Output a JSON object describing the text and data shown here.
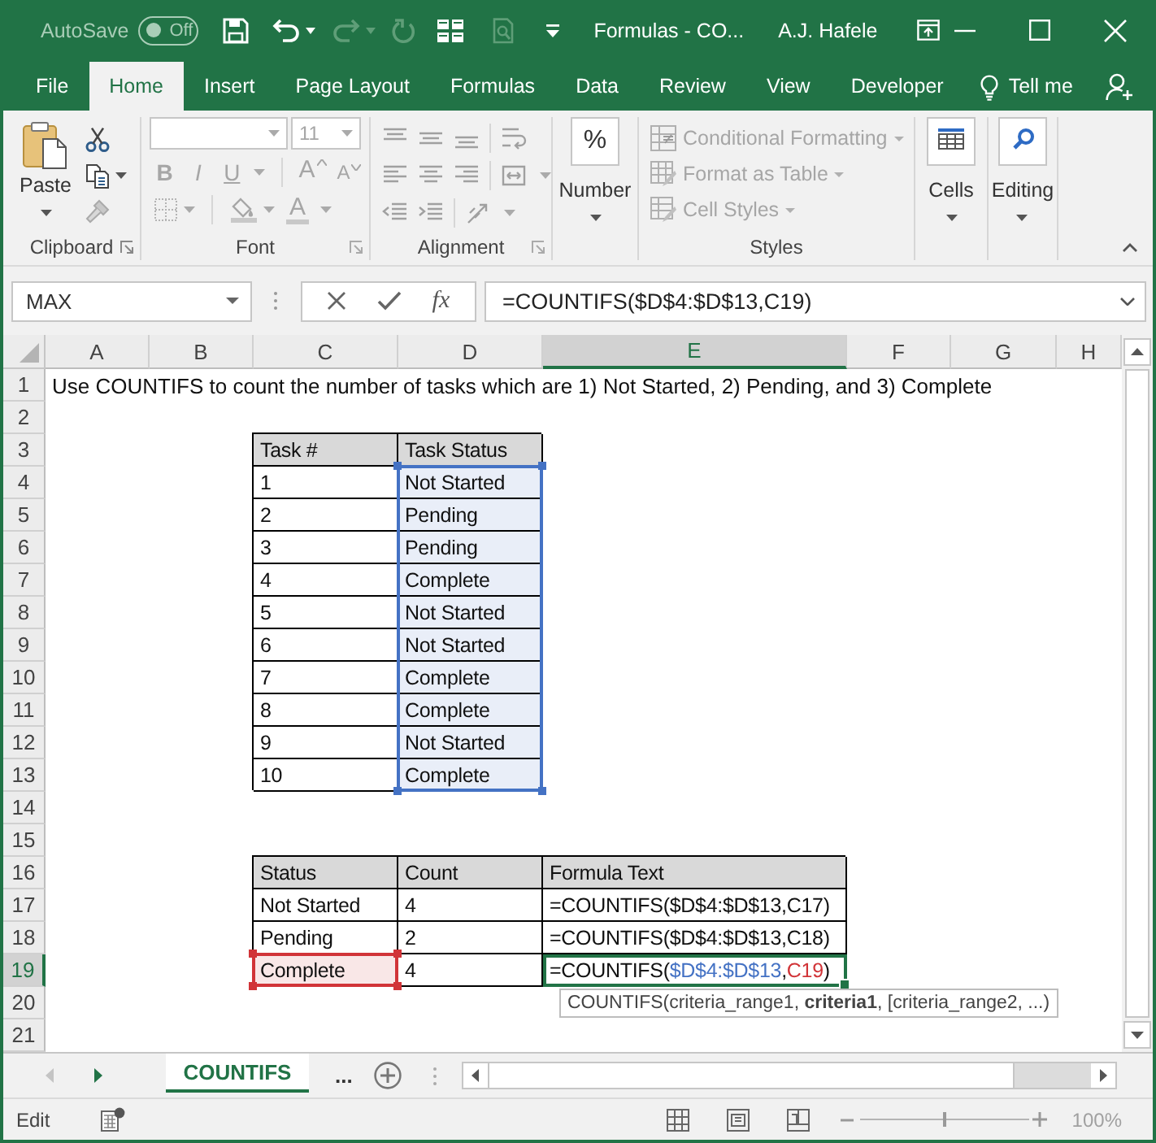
{
  "title_bar": {
    "autosave": {
      "label": "AutoSave",
      "state_text": "Off",
      "on": false
    },
    "title": "Formulas - CO...",
    "user": "A.J. Hafele"
  },
  "ribbon_tabs": [
    {
      "label": "File",
      "selected": false
    },
    {
      "label": "Home",
      "selected": true
    },
    {
      "label": "Insert",
      "selected": false
    },
    {
      "label": "Page Layout",
      "selected": false
    },
    {
      "label": "Formulas",
      "selected": false
    },
    {
      "label": "Data",
      "selected": false
    },
    {
      "label": "Review",
      "selected": false
    },
    {
      "label": "View",
      "selected": false
    },
    {
      "label": "Developer",
      "selected": false
    }
  ],
  "tell_me": "Tell me",
  "ribbon": {
    "clipboard": {
      "paste": "Paste",
      "label": "Clipboard"
    },
    "font": {
      "size": "11",
      "buttons": [
        {
          "kind": "bold",
          "glyph": "B",
          "disabled": true
        },
        {
          "kind": "italic",
          "glyph": "I",
          "disabled": true
        },
        {
          "kind": "underline",
          "glyph": "U",
          "disabled": true
        },
        {
          "kind": "grow",
          "glyph": "A",
          "disabled": true
        },
        {
          "kind": "shrink",
          "glyph": "A",
          "disabled": true
        }
      ],
      "color_glyph": "A",
      "label": "Font"
    },
    "alignment": {
      "label": "Alignment"
    },
    "number": {
      "glyph": "%",
      "label": "Number"
    },
    "styles": {
      "commands": [
        {
          "kind": "conditional",
          "label": "Conditional Formatting",
          "disabled": true
        },
        {
          "kind": "table",
          "label": "Format as Table",
          "disabled": true
        },
        {
          "kind": "cell_styles",
          "label": "Cell Styles",
          "disabled": true
        }
      ],
      "label": "Styles"
    },
    "cells": {
      "label": "Cells"
    },
    "editing": {
      "label": "Editing"
    }
  },
  "formula_bar": {
    "name_box": "MAX",
    "function_glyph": "fx",
    "formula": "=COUNTIFS($D$4:$D$13,C19)"
  },
  "sheet": {
    "columns": [
      {
        "label": "A",
        "selected": false
      },
      {
        "label": "B",
        "selected": false
      },
      {
        "label": "C",
        "selected": false
      },
      {
        "label": "D",
        "selected": false
      },
      {
        "label": "E",
        "selected": true
      },
      {
        "label": "F",
        "selected": false
      },
      {
        "label": "G",
        "selected": false
      },
      {
        "label": "H",
        "selected": false
      }
    ],
    "rows": [
      {
        "label": "1",
        "selected": false,
        "cells": [
          {
            "kind": "plain",
            "text": "Use COUNTIFS to count the number of tasks which are 1) Not Started, 2) Pending, and 3) Complete",
            "selected": false
          }
        ]
      },
      {
        "label": "2",
        "selected": false
      },
      {
        "label": "3",
        "selected": false,
        "cells": [
          null,
          null,
          {
            "kind": "header",
            "text": "Task #",
            "selected": false
          },
          {
            "kind": "header",
            "text": "Task Status",
            "selected": false
          }
        ]
      },
      {
        "label": "4",
        "selected": false,
        "cells": [
          null,
          null,
          {
            "kind": "body",
            "text": "1",
            "selected": false
          },
          {
            "kind": "range",
            "text": "Not Started",
            "selected": false
          }
        ]
      },
      {
        "label": "5",
        "selected": false,
        "cells": [
          null,
          null,
          {
            "kind": "body",
            "text": "2",
            "selected": false
          },
          {
            "kind": "range",
            "text": "Pending",
            "selected": false
          }
        ]
      },
      {
        "label": "6",
        "selected": false,
        "cells": [
          null,
          null,
          {
            "kind": "body",
            "text": "3",
            "selected": false
          },
          {
            "kind": "range",
            "text": "Pending",
            "selected": false
          }
        ]
      },
      {
        "label": "7",
        "selected": false,
        "cells": [
          null,
          null,
          {
            "kind": "body",
            "text": "4",
            "selected": false
          },
          {
            "kind": "range",
            "text": "Complete",
            "selected": false
          }
        ]
      },
      {
        "label": "8",
        "selected": false,
        "cells": [
          null,
          null,
          {
            "kind": "body",
            "text": "5",
            "selected": false
          },
          {
            "kind": "range",
            "text": "Not Started",
            "selected": false
          }
        ]
      },
      {
        "label": "9",
        "selected": false,
        "cells": [
          null,
          null,
          {
            "kind": "body",
            "text": "6",
            "selected": false
          },
          {
            "kind": "range",
            "text": "Not Started",
            "selected": false
          }
        ]
      },
      {
        "label": "10",
        "selected": false,
        "cells": [
          null,
          null,
          {
            "kind": "body",
            "text": "7",
            "selected": false
          },
          {
            "kind": "range",
            "text": "Complete",
            "selected": false
          }
        ]
      },
      {
        "label": "11",
        "selected": false,
        "cells": [
          null,
          null,
          {
            "kind": "body",
            "text": "8",
            "selected": false
          },
          {
            "kind": "range",
            "text": "Complete",
            "selected": false
          }
        ]
      },
      {
        "label": "12",
        "selected": false,
        "cells": [
          null,
          null,
          {
            "kind": "body",
            "text": "9",
            "selected": false
          },
          {
            "kind": "range",
            "text": "Not Started",
            "selected": false
          }
        ]
      },
      {
        "label": "13",
        "selected": false,
        "cells": [
          null,
          null,
          {
            "kind": "body",
            "text": "10",
            "selected": false
          },
          {
            "kind": "range",
            "text": "Complete",
            "selected": false
          }
        ]
      },
      {
        "label": "14",
        "selected": false
      },
      {
        "label": "15",
        "selected": false
      },
      {
        "label": "16",
        "selected": false,
        "cells": [
          null,
          null,
          {
            "kind": "header",
            "text": "Status",
            "selected": false
          },
          {
            "kind": "header",
            "text": "Count",
            "selected": false
          },
          {
            "kind": "header",
            "text": "Formula Text",
            "selected": false
          }
        ]
      },
      {
        "label": "17",
        "selected": false,
        "cells": [
          null,
          null,
          {
            "kind": "body",
            "text": "Not Started",
            "selected": false
          },
          {
            "kind": "body",
            "text": "4",
            "selected": false
          },
          {
            "kind": "body",
            "text": "=COUNTIFS($D$4:$D$13,C17)",
            "selected": false
          }
        ]
      },
      {
        "label": "18",
        "selected": false,
        "cells": [
          null,
          null,
          {
            "kind": "body",
            "text": "Pending",
            "selected": false
          },
          {
            "kind": "body",
            "text": "2",
            "selected": false
          },
          {
            "kind": "body",
            "text": "=COUNTIFS($D$4:$D$13,C18)",
            "selected": false
          }
        ]
      },
      {
        "label": "19",
        "selected": true,
        "cells": [
          null,
          null,
          {
            "kind": "criteria",
            "text": "Complete",
            "selected": false
          },
          {
            "kind": "body",
            "text": "4",
            "selected": false
          },
          {
            "kind": "body",
            "parts": [
              {
                "text": "=COUNTIFS("
              },
              {
                "kind": "range",
                "text": "$D$4:$D$13",
                "color": "#4472c4"
              },
              {
                "text": ","
              },
              {
                "kind": "criteria",
                "text": "C19",
                "color": "#d13438"
              },
              {
                "text": ")"
              }
            ],
            "selected": true
          }
        ]
      },
      {
        "label": "20",
        "selected": false
      },
      {
        "label": "21",
        "selected": false
      }
    ]
  },
  "tooltip": "COUNTIFS(criteria_range1, **criteria1**, [criteria_range2, ...)",
  "sheet_tabs": {
    "tabs": [
      {
        "label": "COUNTIFS",
        "selected": true
      }
    ],
    "more": "..."
  },
  "status_bar": {
    "mode": "Edit",
    "zoom_slider": {
      "level": 0.5
    },
    "zoom": "100%"
  }
}
